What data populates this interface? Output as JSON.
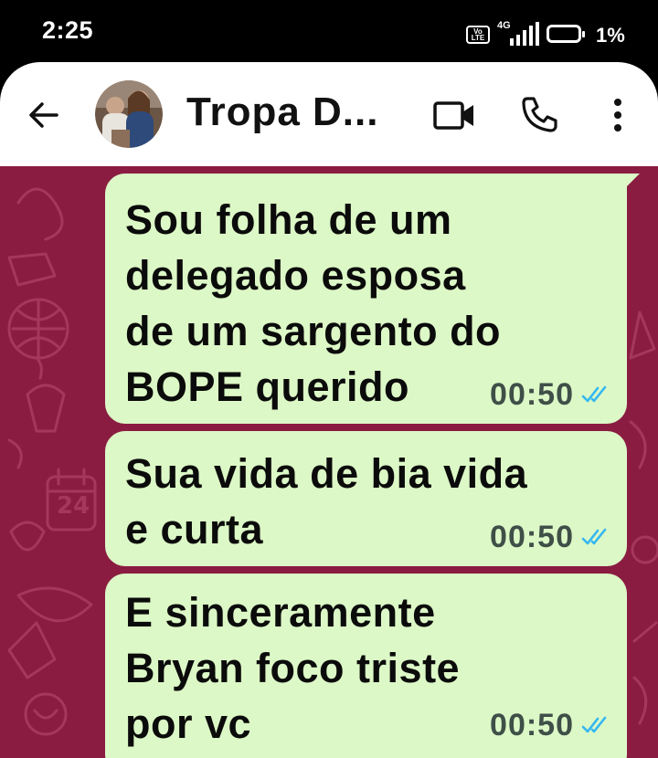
{
  "status_bar": {
    "time": "2:25",
    "volte_label": "Vo\nLTE",
    "network_label": "4G",
    "battery_percent": "1%"
  },
  "header": {
    "title": "Tropa D...",
    "icons": [
      "back-arrow-icon",
      "video-call-icon",
      "phone-icon",
      "more-vert-icon"
    ]
  },
  "messages": [
    {
      "text": "Sou folha de um\ndelegado esposa\nde um sargento do\nBOPE querido",
      "time": "00:50",
      "status": "read"
    },
    {
      "text": "Sua vida de bia vida\ne curta",
      "time": "00:50",
      "status": "read"
    },
    {
      "text": "E sinceramente\nBryan foco triste\npor vc",
      "time": "00:50",
      "status": "read"
    }
  ],
  "colors": {
    "wallpaper": "#8a1c42",
    "bubble": "#dcf8c6",
    "read_ticks": "#34b7f1"
  }
}
